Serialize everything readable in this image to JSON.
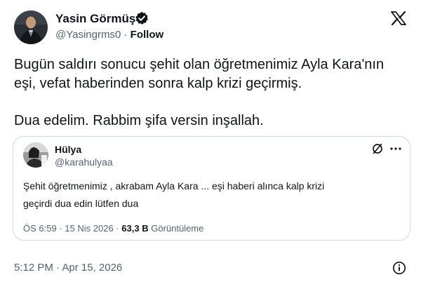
{
  "author": {
    "name": "Yasin Görmüş",
    "handle": "@Yasingrms0",
    "separator": "·",
    "follow_label": "Follow",
    "verified": true
  },
  "logo_icon": "x-logo-icon",
  "tweet": {
    "lines": [
      "Bugün saldırı sonucu şehit olan öğretmenimiz Ayla Kara'nın",
      "eşi, vefat haberinden sonra kalp krizi geçirmiş.",
      "Dua edelim. Rabbim şifa versin inşallah."
    ]
  },
  "quoted": {
    "name": "Hülya",
    "handle": "@karahulyaa",
    "lines": [
      "Şehit öğretmenimiz , akrabam Ayla Kara ... eşi haberi alınca kalp krizi",
      "geçirdi dua edin lütfen dua"
    ],
    "time": "ÖS 6:59",
    "separator": "·",
    "date": "15 Nis 2026",
    "views_count": "63,3 B",
    "views_label": "Görüntüleme",
    "icons": [
      "no-entry-icon",
      "more-icon"
    ]
  },
  "timestamp": "5:12 PM · Apr 15, 2026",
  "footer_icon": "info-icon",
  "colors": {
    "text": "#0f1419",
    "muted": "#536471",
    "border": "#cfd9de"
  }
}
